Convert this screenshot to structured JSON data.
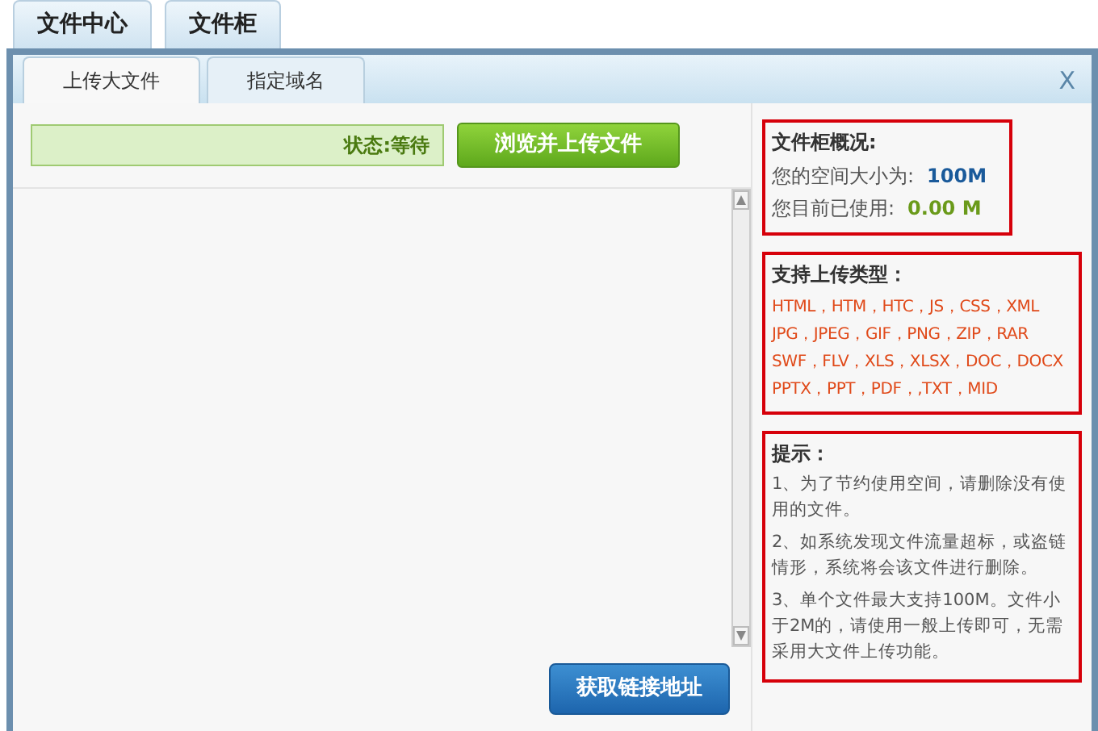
{
  "top_tabs": [
    {
      "label": "文件中心"
    },
    {
      "label": "文件柜"
    }
  ],
  "dialog": {
    "close": "X",
    "tabs": [
      {
        "label": "上传大文件",
        "selected": true
      },
      {
        "label": "指定域名",
        "selected": false
      }
    ]
  },
  "upload": {
    "status": "状态:等待",
    "browse_button": "浏览并上传文件",
    "get_link_button": "获取链接地址"
  },
  "overview": {
    "title": "文件柜概况:",
    "rows": [
      {
        "label": "您的空间大小为:",
        "value": "100M",
        "color": "#1a5a9a"
      },
      {
        "label": "您目前已使用:",
        "value": "0.00 M",
        "color": "#6a9a1a"
      }
    ]
  },
  "types": {
    "title": "支持上传类型：",
    "lines": [
      "HTML，HTM，HTC，JS，CSS，XML",
      "JPG，JPEG，GIF，PNG，ZIP，RAR",
      "SWF，FLV，XLS，XLSX，DOC，DOCX",
      "PPTX，PPT，PDF，,TXT，MID"
    ]
  },
  "tips": {
    "title": "提示：",
    "items": [
      "1、为了节约使用空间，请删除没有使用的文件。",
      "2、如系统发现文件流量超标，或盗链情形，系统将会该文件进行删除。",
      "3、单个文件最大支持100M。文件小于2M的，请使用一般上传即可，无需采用大文件上传功能。"
    ]
  }
}
